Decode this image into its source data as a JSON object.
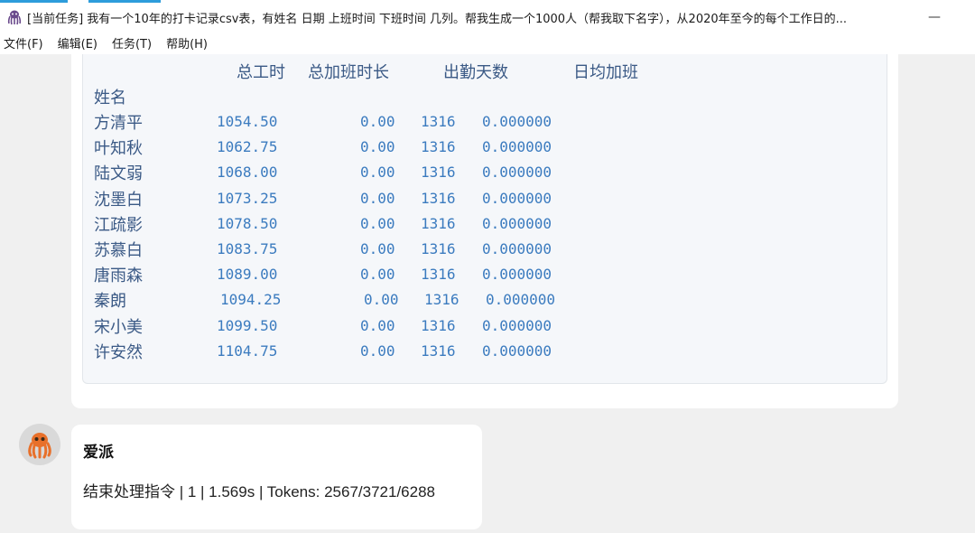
{
  "window": {
    "title": "[当前任务] 我有一个10年的打卡记录csv表，有姓名 日期 上班时间 下班时间 几列。帮我生成一个1000人（帮我取下名字），从2020年至今的每个工作日的...",
    "minimize_label": "—"
  },
  "menu": {
    "items": [
      "文件(F)",
      "编辑(E)",
      "任务(T)",
      "帮助(H)"
    ]
  },
  "table": {
    "columns": [
      "总工时",
      "总加班时长",
      "出勤天数",
      "日均加班"
    ],
    "index_label": "姓名",
    "rows": [
      {
        "name": "方清平",
        "total_hours": "1054.50",
        "overtime": "0.00",
        "days": "1316",
        "avg_overtime": "0.000000"
      },
      {
        "name": "叶知秋",
        "total_hours": "1062.75",
        "overtime": "0.00",
        "days": "1316",
        "avg_overtime": "0.000000"
      },
      {
        "name": "陆文弱",
        "total_hours": "1068.00",
        "overtime": "0.00",
        "days": "1316",
        "avg_overtime": "0.000000"
      },
      {
        "name": "沈墨白",
        "total_hours": "1073.25",
        "overtime": "0.00",
        "days": "1316",
        "avg_overtime": "0.000000"
      },
      {
        "name": "江疏影",
        "total_hours": "1078.50",
        "overtime": "0.00",
        "days": "1316",
        "avg_overtime": "0.000000"
      },
      {
        "name": "苏慕白",
        "total_hours": "1083.75",
        "overtime": "0.00",
        "days": "1316",
        "avg_overtime": "0.000000"
      },
      {
        "name": "唐雨森",
        "total_hours": "1089.00",
        "overtime": "0.00",
        "days": "1316",
        "avg_overtime": "0.000000"
      },
      {
        "name": "秦朗",
        "total_hours": "1094.25",
        "overtime": "0.00",
        "days": "1316",
        "avg_overtime": "0.000000"
      },
      {
        "name": "宋小美",
        "total_hours": "1099.50",
        "overtime": "0.00",
        "days": "1316",
        "avg_overtime": "0.000000"
      },
      {
        "name": "许安然",
        "total_hours": "1104.75",
        "overtime": "0.00",
        "days": "1316",
        "avg_overtime": "0.000000"
      }
    ]
  },
  "reply": {
    "avatar_icon": "octopus-icon",
    "sender": "爱派",
    "text": "结束处理指令 | 1 | 1.569s | Tokens: 2567/3721/6288"
  },
  "colors": {
    "accent": "#2d9cdb",
    "table_text": "#3b5a86",
    "number_text": "#3b7bbf",
    "avatar_orange": "#e8702a"
  }
}
